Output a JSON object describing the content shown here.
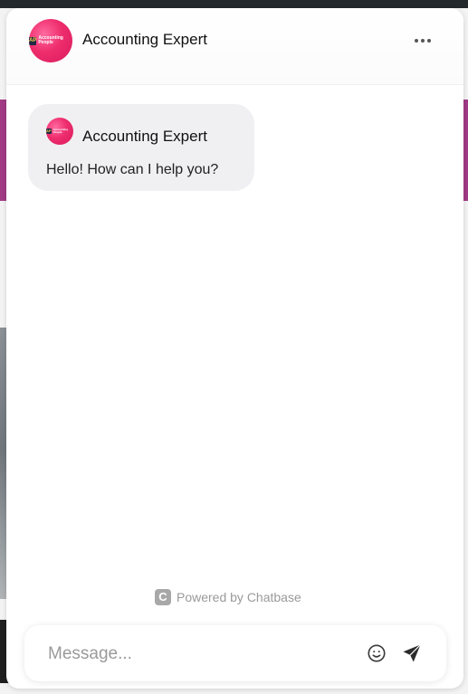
{
  "header": {
    "title": "Accounting Expert",
    "avatar_text": "Accounting People",
    "avatar_mark": "AP",
    "menu_icon": "more-horizontal-icon"
  },
  "messages": [
    {
      "sender": "Accounting Expert",
      "text": "Hello! How can I help you?"
    }
  ],
  "footer": {
    "powered_by": "Powered by Chatbase",
    "powered_logo": "C"
  },
  "composer": {
    "placeholder": "Message...",
    "value": "",
    "emoji_icon": "smiley-icon",
    "send_icon": "send-icon"
  },
  "colors": {
    "brand": "#ee2d6d",
    "bubble": "#f0f0f2",
    "background_accent": "#a23a86"
  }
}
